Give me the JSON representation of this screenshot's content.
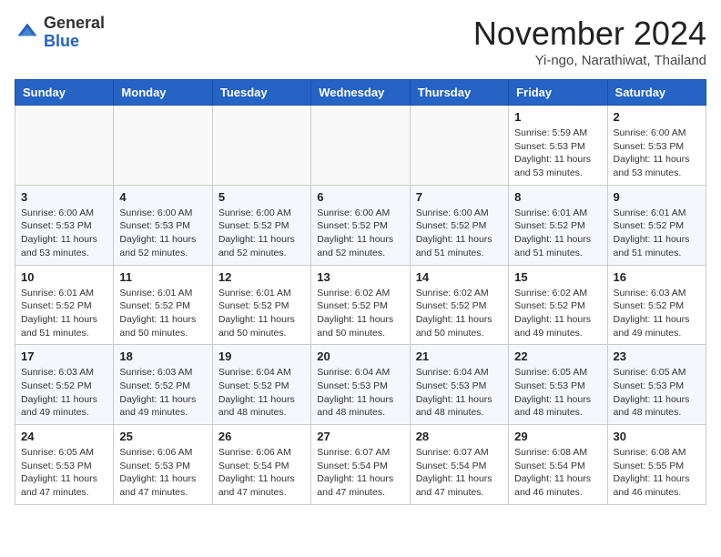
{
  "header": {
    "logo": {
      "line1": "General",
      "line2": "Blue"
    },
    "title": "November 2024",
    "location": "Yi-ngo, Narathiwat, Thailand"
  },
  "weekdays": [
    "Sunday",
    "Monday",
    "Tuesday",
    "Wednesday",
    "Thursday",
    "Friday",
    "Saturday"
  ],
  "weeks": [
    [
      {
        "day": "",
        "info": ""
      },
      {
        "day": "",
        "info": ""
      },
      {
        "day": "",
        "info": ""
      },
      {
        "day": "",
        "info": ""
      },
      {
        "day": "",
        "info": ""
      },
      {
        "day": "1",
        "info": "Sunrise: 5:59 AM\nSunset: 5:53 PM\nDaylight: 11 hours\nand 53 minutes."
      },
      {
        "day": "2",
        "info": "Sunrise: 6:00 AM\nSunset: 5:53 PM\nDaylight: 11 hours\nand 53 minutes."
      }
    ],
    [
      {
        "day": "3",
        "info": "Sunrise: 6:00 AM\nSunset: 5:53 PM\nDaylight: 11 hours\nand 53 minutes."
      },
      {
        "day": "4",
        "info": "Sunrise: 6:00 AM\nSunset: 5:53 PM\nDaylight: 11 hours\nand 52 minutes."
      },
      {
        "day": "5",
        "info": "Sunrise: 6:00 AM\nSunset: 5:52 PM\nDaylight: 11 hours\nand 52 minutes."
      },
      {
        "day": "6",
        "info": "Sunrise: 6:00 AM\nSunset: 5:52 PM\nDaylight: 11 hours\nand 52 minutes."
      },
      {
        "day": "7",
        "info": "Sunrise: 6:00 AM\nSunset: 5:52 PM\nDaylight: 11 hours\nand 51 minutes."
      },
      {
        "day": "8",
        "info": "Sunrise: 6:01 AM\nSunset: 5:52 PM\nDaylight: 11 hours\nand 51 minutes."
      },
      {
        "day": "9",
        "info": "Sunrise: 6:01 AM\nSunset: 5:52 PM\nDaylight: 11 hours\nand 51 minutes."
      }
    ],
    [
      {
        "day": "10",
        "info": "Sunrise: 6:01 AM\nSunset: 5:52 PM\nDaylight: 11 hours\nand 51 minutes."
      },
      {
        "day": "11",
        "info": "Sunrise: 6:01 AM\nSunset: 5:52 PM\nDaylight: 11 hours\nand 50 minutes."
      },
      {
        "day": "12",
        "info": "Sunrise: 6:01 AM\nSunset: 5:52 PM\nDaylight: 11 hours\nand 50 minutes."
      },
      {
        "day": "13",
        "info": "Sunrise: 6:02 AM\nSunset: 5:52 PM\nDaylight: 11 hours\nand 50 minutes."
      },
      {
        "day": "14",
        "info": "Sunrise: 6:02 AM\nSunset: 5:52 PM\nDaylight: 11 hours\nand 50 minutes."
      },
      {
        "day": "15",
        "info": "Sunrise: 6:02 AM\nSunset: 5:52 PM\nDaylight: 11 hours\nand 49 minutes."
      },
      {
        "day": "16",
        "info": "Sunrise: 6:03 AM\nSunset: 5:52 PM\nDaylight: 11 hours\nand 49 minutes."
      }
    ],
    [
      {
        "day": "17",
        "info": "Sunrise: 6:03 AM\nSunset: 5:52 PM\nDaylight: 11 hours\nand 49 minutes."
      },
      {
        "day": "18",
        "info": "Sunrise: 6:03 AM\nSunset: 5:52 PM\nDaylight: 11 hours\nand 49 minutes."
      },
      {
        "day": "19",
        "info": "Sunrise: 6:04 AM\nSunset: 5:52 PM\nDaylight: 11 hours\nand 48 minutes."
      },
      {
        "day": "20",
        "info": "Sunrise: 6:04 AM\nSunset: 5:53 PM\nDaylight: 11 hours\nand 48 minutes."
      },
      {
        "day": "21",
        "info": "Sunrise: 6:04 AM\nSunset: 5:53 PM\nDaylight: 11 hours\nand 48 minutes."
      },
      {
        "day": "22",
        "info": "Sunrise: 6:05 AM\nSunset: 5:53 PM\nDaylight: 11 hours\nand 48 minutes."
      },
      {
        "day": "23",
        "info": "Sunrise: 6:05 AM\nSunset: 5:53 PM\nDaylight: 11 hours\nand 48 minutes."
      }
    ],
    [
      {
        "day": "24",
        "info": "Sunrise: 6:05 AM\nSunset: 5:53 PM\nDaylight: 11 hours\nand 47 minutes."
      },
      {
        "day": "25",
        "info": "Sunrise: 6:06 AM\nSunset: 5:53 PM\nDaylight: 11 hours\nand 47 minutes."
      },
      {
        "day": "26",
        "info": "Sunrise: 6:06 AM\nSunset: 5:54 PM\nDaylight: 11 hours\nand 47 minutes."
      },
      {
        "day": "27",
        "info": "Sunrise: 6:07 AM\nSunset: 5:54 PM\nDaylight: 11 hours\nand 47 minutes."
      },
      {
        "day": "28",
        "info": "Sunrise: 6:07 AM\nSunset: 5:54 PM\nDaylight: 11 hours\nand 47 minutes."
      },
      {
        "day": "29",
        "info": "Sunrise: 6:08 AM\nSunset: 5:54 PM\nDaylight: 11 hours\nand 46 minutes."
      },
      {
        "day": "30",
        "info": "Sunrise: 6:08 AM\nSunset: 5:55 PM\nDaylight: 11 hours\nand 46 minutes."
      }
    ]
  ]
}
